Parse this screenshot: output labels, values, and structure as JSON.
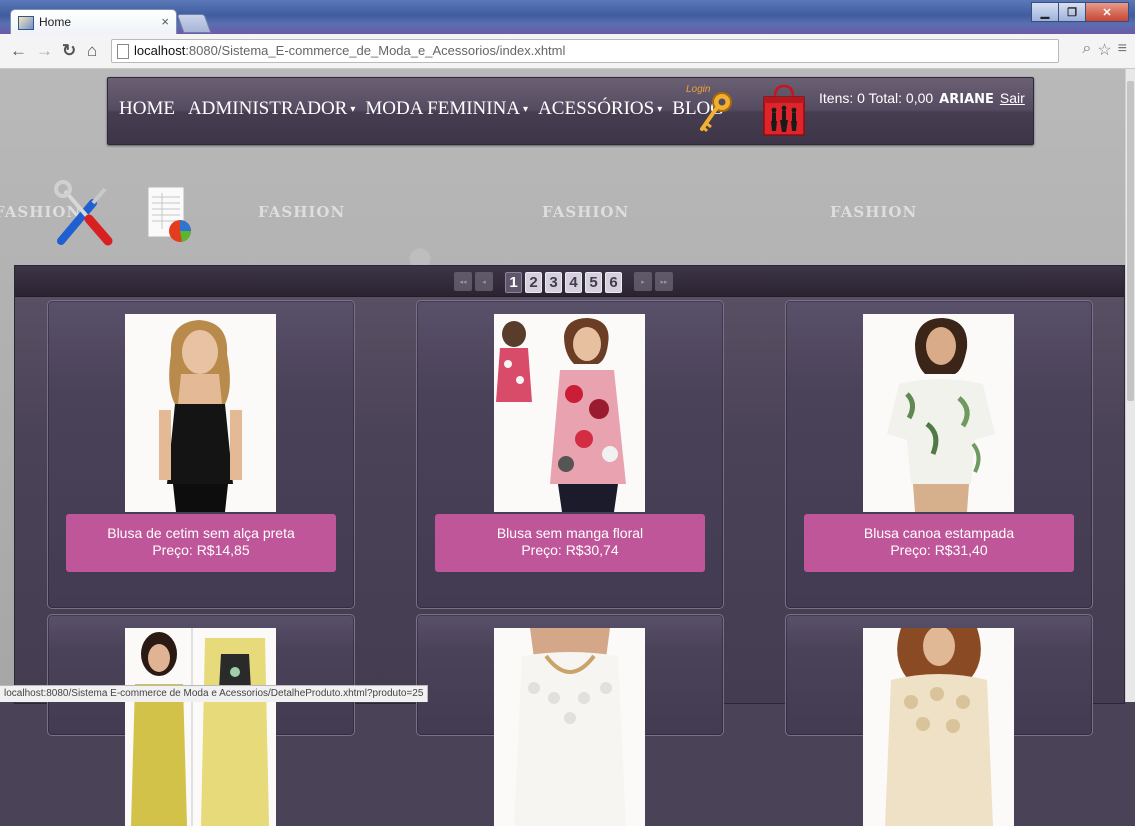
{
  "browser": {
    "tab_title": "Home",
    "tab_close": "×",
    "url_host": "localhost",
    "url_rest": ":8080/Sistema_E-commerce_de_Moda_e_Acessorios/index.xhtml",
    "status_url": "localhost:8080/Sistema E-commerce de Moda e Acessorios/DetalheProduto.xhtml?produto=25"
  },
  "watermark": {
    "word": "FASHION"
  },
  "menu": {
    "items": [
      {
        "label": "HOME",
        "caret": ""
      },
      {
        "label": "ADMINISTRADOR",
        "caret": "▾"
      },
      {
        "label": "MODA FEMININA",
        "caret": "▾"
      },
      {
        "label": "ACESSÓRIOS",
        "caret": "▾"
      },
      {
        "label": "BLOG",
        "caret": ""
      }
    ],
    "login_label": "Login",
    "cart_summary": "Itens: 0 Total: 0,00",
    "user": "ARIANE",
    "logout": "Sair"
  },
  "pagination": {
    "first": "◂◂",
    "prev": "◂",
    "next": "▸",
    "last": "▸▸",
    "pages": [
      "1",
      "2",
      "3",
      "4",
      "5",
      "6"
    ],
    "current": "1"
  },
  "products": [
    {
      "name": "Blusa de cetim sem alça preta",
      "price": "Preço: R$14,85"
    },
    {
      "name": "Blusa sem manga floral",
      "price": "Preço: R$30,74"
    },
    {
      "name": "Blusa canoa estampada",
      "price": "Preço: R$31,40"
    }
  ],
  "colors": {
    "menu_bg": "#4e4559",
    "card_bg": "#4a4258",
    "label_bg": "#c0569a",
    "accent_login": "#f0a23a"
  }
}
